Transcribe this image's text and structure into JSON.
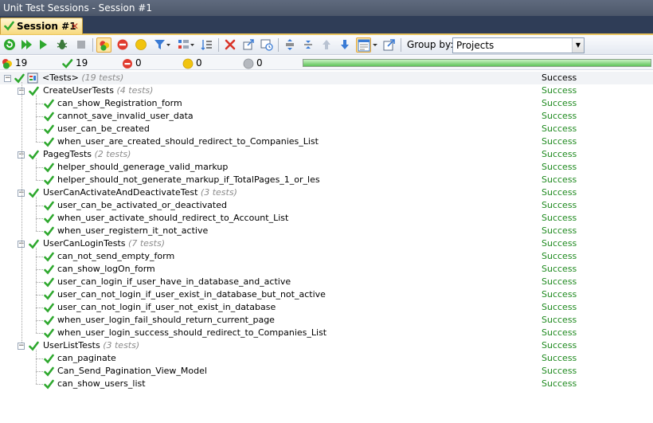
{
  "window": {
    "title": "Unit Test Sessions - Session #1"
  },
  "session_tab": {
    "label": "Session #1"
  },
  "toolbar": {
    "group_by_label": "Group by:",
    "group_by_value": "Projects"
  },
  "status": {
    "total": "19",
    "passed": "19",
    "failed": "0",
    "ignored": "0",
    "unknown": "0",
    "progress_fraction": 1.0
  },
  "colors": {
    "success_text": "#1f8a1f",
    "check_green": "#2ea82e",
    "progress_green": "#5fc35a"
  },
  "tree": {
    "root": {
      "label": "<Tests>",
      "count": "(19 tests)",
      "result": "Success"
    },
    "groups": [
      {
        "label": "CreateUserTests",
        "count": "(4 tests)",
        "result": "Success",
        "tests": [
          {
            "label": "can_show_Registration_form",
            "result": "Success"
          },
          {
            "label": "cannot_save_invalid_user_data",
            "result": "Success"
          },
          {
            "label": "user_can_be_created",
            "result": "Success"
          },
          {
            "label": "when_user_are_created_should_redirect_to_Companies_List",
            "result": "Success"
          }
        ]
      },
      {
        "label": "PagegTests",
        "count": "(2 tests)",
        "result": "Success",
        "tests": [
          {
            "label": "helper_should_generage_valid_markup",
            "result": "Success"
          },
          {
            "label": "helper_should_not_generate_markup_if_TotalPages_1_or_les",
            "result": "Success"
          }
        ]
      },
      {
        "label": "UserCanActivateAndDeactivateTest",
        "count": "(3 tests)",
        "result": "Success",
        "tests": [
          {
            "label": "user_can_be_activated_or_deactivated",
            "result": "Success"
          },
          {
            "label": "when_user_activate_should_redirect_to_Account_List",
            "result": "Success"
          },
          {
            "label": "when_user_registern_it_not_active",
            "result": "Success"
          }
        ]
      },
      {
        "label": "UserCanLoginTests",
        "count": "(7 tests)",
        "result": "Success",
        "tests": [
          {
            "label": "can_not_send_empty_form",
            "result": "Success"
          },
          {
            "label": "can_show_logOn_form",
            "result": "Success"
          },
          {
            "label": "user_can_login_if_user_have_in_database_and_active",
            "result": "Success"
          },
          {
            "label": "user_can_not_login_if_user_exist_in_database_but_not_active",
            "result": "Success"
          },
          {
            "label": "user_can_not_login_if_user_not_exist_in_database",
            "result": "Success"
          },
          {
            "label": "when_user_login_fail_should_return_current_page",
            "result": "Success"
          },
          {
            "label": "when_user_login_success_should_redirect_to_Companies_List",
            "result": "Success"
          }
        ]
      },
      {
        "label": "UserListTests",
        "count": "(3 tests)",
        "result": "Success",
        "tests": [
          {
            "label": "can_paginate",
            "result": "Success"
          },
          {
            "label": "Can_Send_Pagination_View_Model",
            "result": "Success"
          },
          {
            "label": "can_show_users_list",
            "result": "Success"
          }
        ]
      }
    ]
  }
}
